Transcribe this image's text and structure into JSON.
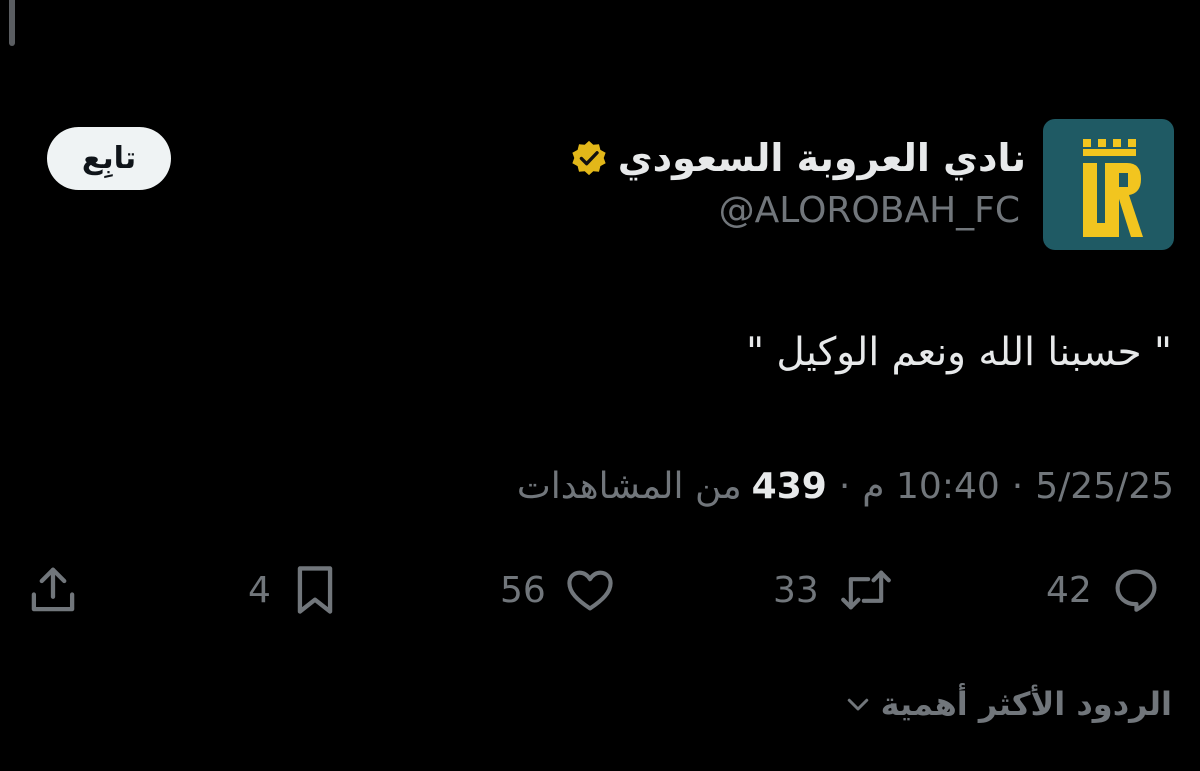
{
  "profile": {
    "display_name": "نادي العروبة السعودي",
    "handle": "@ALOROBAH_FC",
    "verified_icon": "verified-gold-badge-icon",
    "avatar_color": "#1f5a64",
    "logo_color": "#f2c51f",
    "follow_label": "تابِع"
  },
  "tweet": {
    "text": "\" حسبنا الله ونعم الوكيل \"",
    "date": "5/25/25",
    "time": "10:40 م",
    "views_count": "439",
    "views_label": "من المشاهدات"
  },
  "actions": {
    "replies": "42",
    "retweets": "33",
    "likes": "56",
    "bookmarks": "4",
    "reply_icon": "reply-icon",
    "retweet_icon": "retweet-icon",
    "like_icon": "heart-icon",
    "bookmark_icon": "bookmark-icon",
    "share_icon": "share-icon"
  },
  "replies_sort": {
    "label": "الردود الأكثر أهمية",
    "icon": "chevron-down-icon"
  },
  "colors": {
    "background": "#000000",
    "primary_text": "#e7e9ea",
    "secondary_text": "#71767b",
    "button_bg": "#eff3f4"
  }
}
